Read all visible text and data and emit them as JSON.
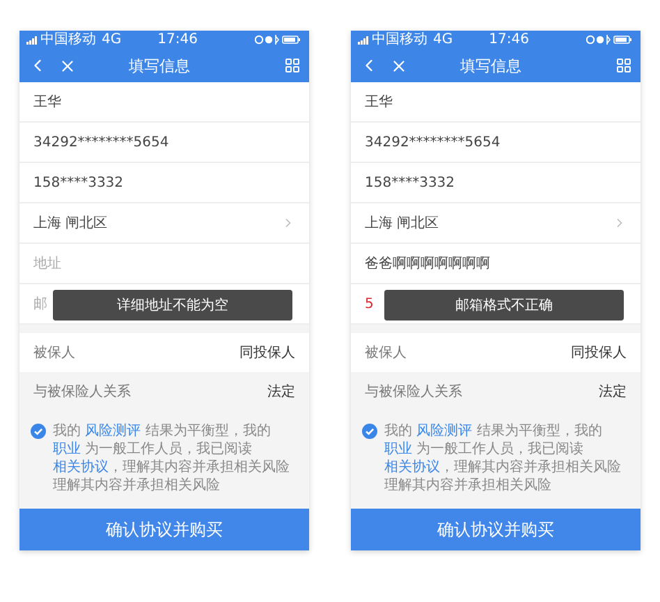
{
  "screens": [
    {
      "status_bar": {
        "carrier": "中国移动",
        "network": "4G",
        "time": "17:46"
      },
      "nav": {
        "title": "填写信息"
      },
      "fields": [
        {
          "kind": "value",
          "text": "王华",
          "invalid": false
        },
        {
          "kind": "value",
          "text": "34292********5654",
          "invalid": false
        },
        {
          "kind": "value",
          "text": "158****3332",
          "invalid": false
        },
        {
          "kind": "select",
          "text": "上海 闸北区",
          "invalid": false
        },
        {
          "kind": "placeholder",
          "text": "地址",
          "invalid": false
        },
        {
          "kind": "placeholder",
          "text": "邮",
          "invalid": false
        }
      ],
      "toast": "详细地址不能为空",
      "insured": [
        {
          "label": "被保人",
          "value": "同投保人"
        },
        {
          "label": "与被保险人关系",
          "value": "法定"
        }
      ],
      "agreement": {
        "checked": true,
        "parts": [
          {
            "text": "我的 ",
            "link": false
          },
          {
            "text": "风险测评",
            "link": true
          },
          {
            "text": " 结果为平衡型，我的 ",
            "link": false
          },
          {
            "text": "职业",
            "link": true
          },
          {
            "text": " 为一般工作人员，我已阅读 ",
            "link": false
          },
          {
            "text": "相关协议",
            "link": true
          },
          {
            "text": "，理解其内容并承担相关风险理解其内容并承担相关风险",
            "link": false
          }
        ]
      },
      "button": "确认协议并购买"
    },
    {
      "status_bar": {
        "carrier": "中国移动",
        "network": "4G",
        "time": "17:46"
      },
      "nav": {
        "title": "填写信息"
      },
      "fields": [
        {
          "kind": "value",
          "text": "王华",
          "invalid": false
        },
        {
          "kind": "value",
          "text": "34292********5654",
          "invalid": false
        },
        {
          "kind": "value",
          "text": "158****3332",
          "invalid": false
        },
        {
          "kind": "select",
          "text": "上海 闸北区",
          "invalid": false
        },
        {
          "kind": "value",
          "text": "爸爸啊啊啊啊啊啊啊",
          "invalid": false
        },
        {
          "kind": "value",
          "text": "5",
          "invalid": true
        }
      ],
      "toast": "邮箱格式不正确",
      "insured": [
        {
          "label": "被保人",
          "value": "同投保人"
        },
        {
          "label": "与被保险人关系",
          "value": "法定"
        }
      ],
      "agreement": {
        "checked": true,
        "parts": [
          {
            "text": "我的 ",
            "link": false
          },
          {
            "text": "风险测评",
            "link": true
          },
          {
            "text": " 结果为平衡型，我的 ",
            "link": false
          },
          {
            "text": "职业",
            "link": true
          },
          {
            "text": " 为一般工作人员，我已阅读 ",
            "link": false
          },
          {
            "text": "相关协议",
            "link": true
          },
          {
            "text": "，理解其内容并承担相关风险理解其内容并承担相关风险",
            "link": false
          }
        ]
      },
      "button": "确认协议并购买"
    }
  ]
}
